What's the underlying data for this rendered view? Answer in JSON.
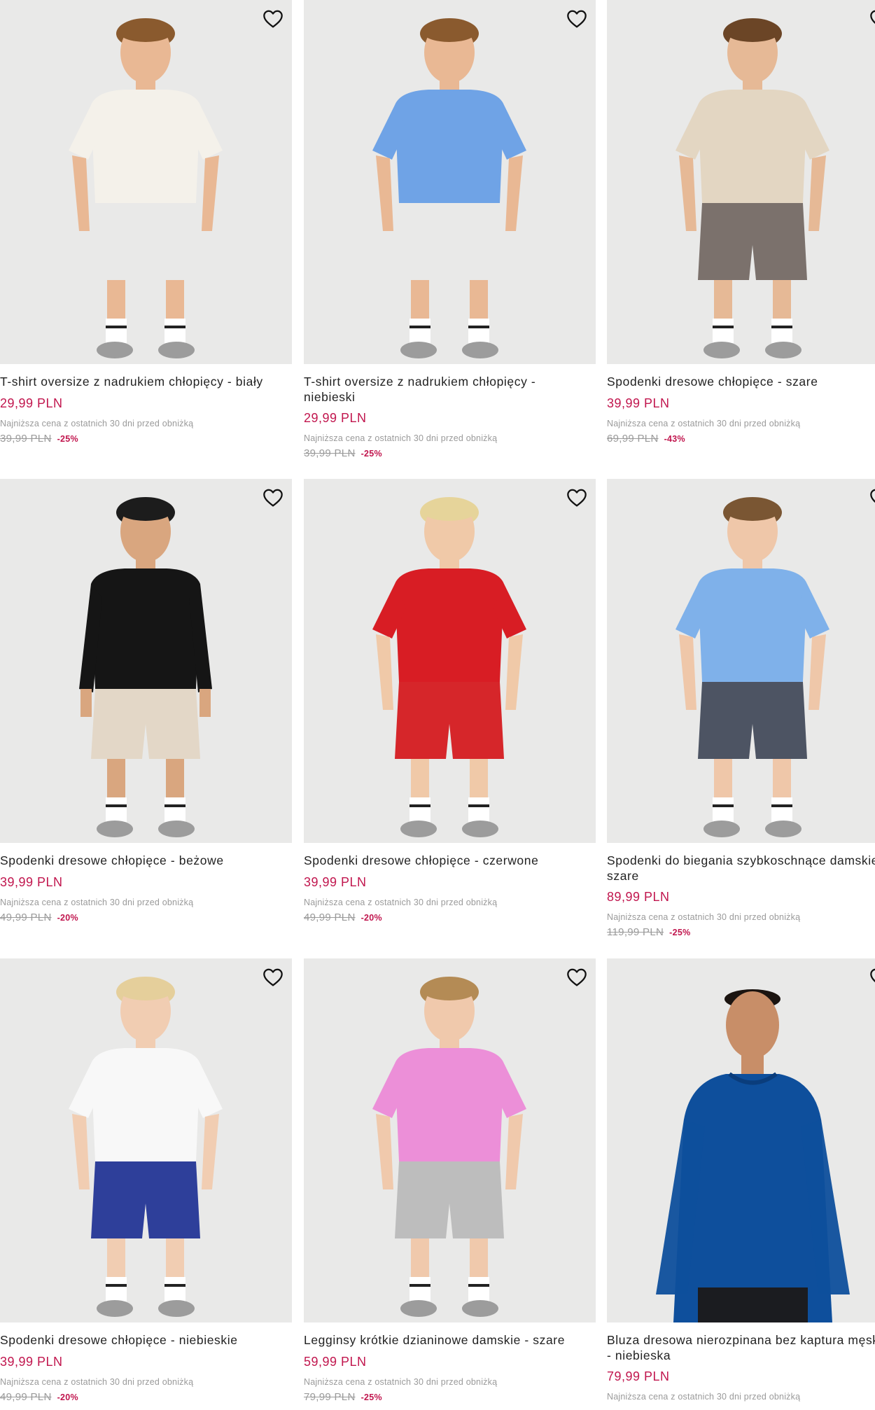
{
  "products": [
    {
      "title": "T-shirt oversize z nadrukiem chłopięcy - biały",
      "price": "29,99 PLN",
      "lowest_label": "Najniższa cena z ostatnich 30 dni przed obniżką",
      "old_price": "39,99 PLN",
      "discount": "-25%",
      "colors": {
        "top": "#f4f1ea",
        "bottom": "#e9e9e8",
        "skin": "#e9b894",
        "hair": "#8a5a2e"
      }
    },
    {
      "title": "T-shirt oversize z nadrukiem chłopięcy - niebieski",
      "price": "29,99 PLN",
      "lowest_label": "Najniższa cena z ostatnich 30 dni przed obniżką",
      "old_price": "39,99 PLN",
      "discount": "-25%",
      "colors": {
        "top": "#6fa3e6",
        "bottom": "#e9e9e8",
        "skin": "#e9b894",
        "hair": "#8a5a2e"
      }
    },
    {
      "title": "Spodenki dresowe chłopięce - szare",
      "price": "39,99 PLN",
      "lowest_label": "Najniższa cena z ostatnich 30 dni przed obniżką",
      "old_price": "69,99 PLN",
      "discount": "-43%",
      "colors": {
        "top": "#e3d6c2",
        "bottom": "#7b716c",
        "skin": "#e6b996",
        "hair": "#6b4526"
      }
    },
    {
      "title": "Spodenki dresowe chłopięce - beżowe",
      "price": "39,99 PLN",
      "lowest_label": "Najniższa cena z ostatnich 30 dni przed obniżką",
      "old_price": "49,99 PLN",
      "discount": "-20%",
      "colors": {
        "top": "#151515",
        "bottom": "#e3d7c7",
        "skin": "#d9a67f",
        "hair": "#1c1c1c"
      }
    },
    {
      "title": "Spodenki dresowe chłopięce - czerwone",
      "price": "39,99 PLN",
      "lowest_label": "Najniższa cena z ostatnich 30 dni przed obniżką",
      "old_price": "49,99 PLN",
      "discount": "-20%",
      "colors": {
        "top": "#d81d24",
        "bottom": "#d6262a",
        "skin": "#f0c9a8",
        "hair": "#e6d49a"
      }
    },
    {
      "title": "Spodenki do biegania szybkoschnące damskie - szare",
      "price": "89,99 PLN",
      "lowest_label": "Najniższa cena z ostatnich 30 dni przed obniżką",
      "old_price": "119,99 PLN",
      "discount": "-25%",
      "colors": {
        "top": "#7fb1ea",
        "bottom": "#4d5463",
        "skin": "#efc7a9",
        "hair": "#7a5633"
      }
    },
    {
      "title": "Spodenki dresowe chłopięce - niebieskie",
      "price": "39,99 PLN",
      "lowest_label": "Najniższa cena z ostatnich 30 dni przed obniżką",
      "old_price": "49,99 PLN",
      "discount": "-20%",
      "colors": {
        "top": "#f8f8f8",
        "bottom": "#2e3f9a",
        "skin": "#f1cdb2",
        "hair": "#e5cf9b"
      }
    },
    {
      "title": "Legginsy krótkie dzianinowe damskie - szare",
      "price": "59,99 PLN",
      "lowest_label": "Najniższa cena z ostatnich 30 dni przed obniżką",
      "old_price": "79,99 PLN",
      "discount": "-25%",
      "colors": {
        "top": "#ec8fd8",
        "bottom": "#bdbdbd",
        "skin": "#f0c9ac",
        "hair": "#b48b55"
      }
    },
    {
      "title": "Bluza dresowa nierozpinana bez kaptura męska - niebieska",
      "price": "79,99 PLN",
      "lowest_label": "Najniższa cena z ostatnich 30 dni przed obniżką",
      "old_price": "",
      "discount": "",
      "colors": {
        "top": "#0e4f9c",
        "bottom": "#1b1c20",
        "skin": "#c88e68",
        "hair": "#1b1410"
      }
    }
  ]
}
